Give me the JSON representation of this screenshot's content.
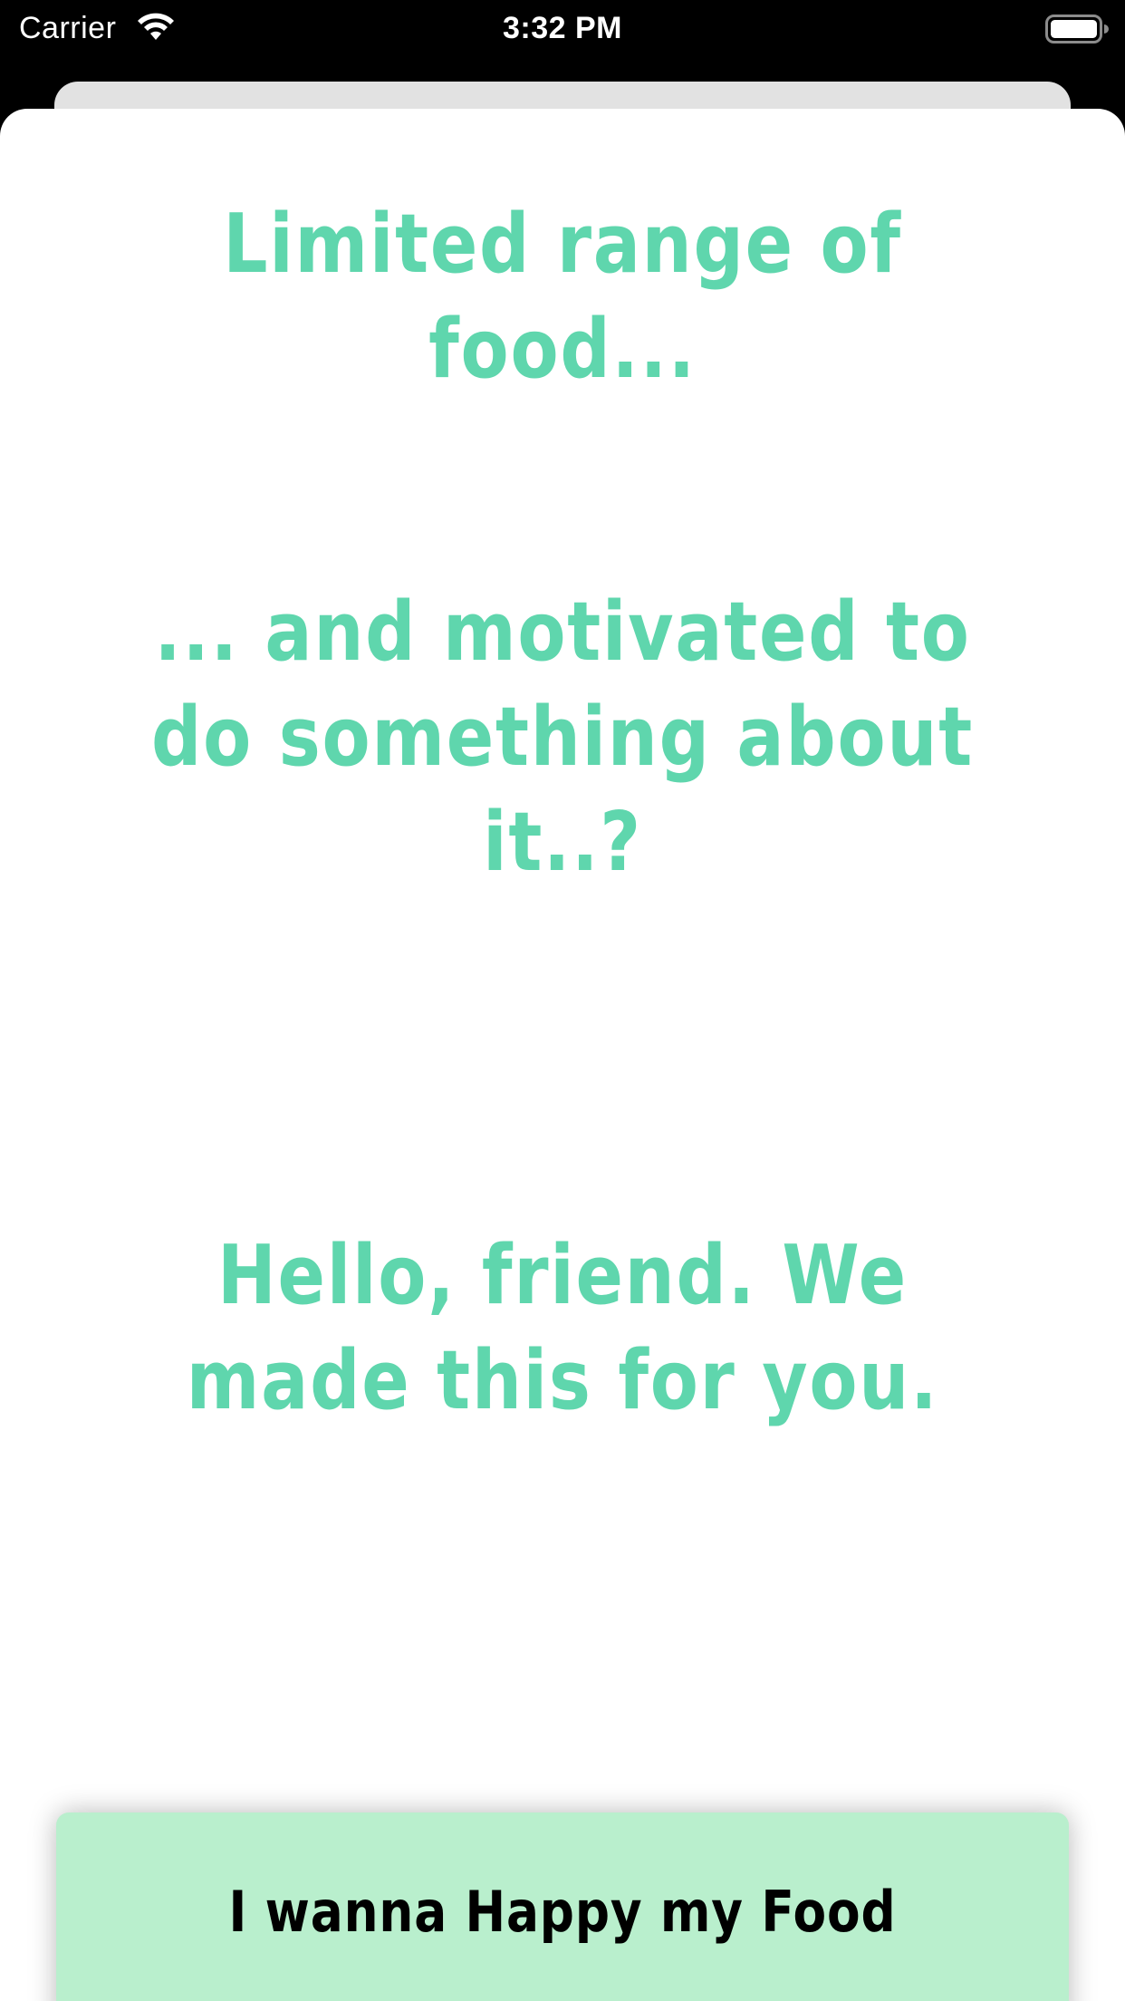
{
  "status_bar": {
    "carrier": "Carrier",
    "time": "3:32 PM",
    "wifi_icon": "wifi-icon",
    "battery_icon": "battery-full-icon"
  },
  "content": {
    "headline_1": "Limited range of food...",
    "headline_2": "... and motivated to do something about it..?",
    "headline_3": "Hello, friend. We made this for you."
  },
  "cta": {
    "label": "I wanna Happy my Food"
  },
  "colors": {
    "accent_text": "#5fd6ad",
    "button_background": "#b9efcd",
    "status_bar_background": "#000000"
  }
}
